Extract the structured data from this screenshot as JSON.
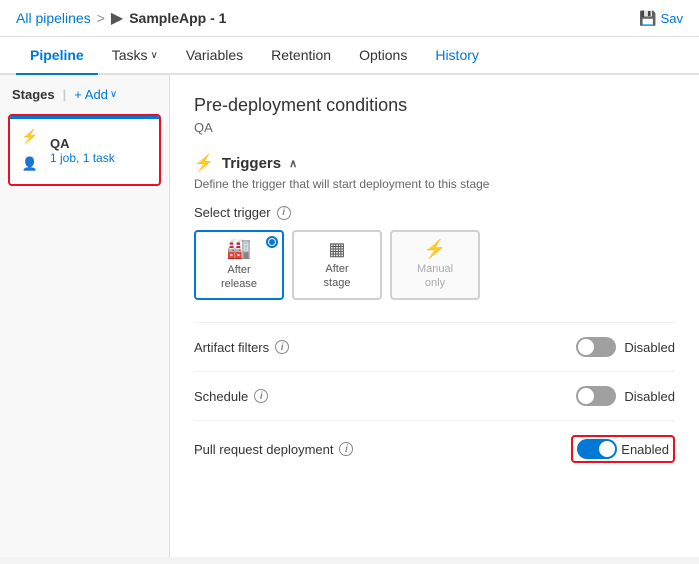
{
  "breadcrumb": {
    "all_pipelines": "All pipelines",
    "separator": ">",
    "app_icon": "▶",
    "current": "SampleApp - 1"
  },
  "save_button": "Sav",
  "nav": {
    "tabs": [
      {
        "id": "pipeline",
        "label": "Pipeline",
        "active": true
      },
      {
        "id": "tasks",
        "label": "Tasks",
        "has_dropdown": true
      },
      {
        "id": "variables",
        "label": "Variables"
      },
      {
        "id": "retention",
        "label": "Retention"
      },
      {
        "id": "options",
        "label": "Options"
      },
      {
        "id": "history",
        "label": "History"
      }
    ]
  },
  "sidebar": {
    "stages_label": "Stages",
    "add_label": "+ Add",
    "stage": {
      "name": "QA",
      "meta": "1 job, 1 task"
    }
  },
  "panel": {
    "title": "Pre-deployment conditions",
    "subtitle": "QA",
    "triggers_section": "Triggers",
    "triggers_desc": "Define the trigger that will start deployment to this stage",
    "select_trigger_label": "Select trigger",
    "trigger_options": [
      {
        "id": "after-release",
        "icon": "🏭",
        "label": "After\nrelease",
        "selected": true
      },
      {
        "id": "after-stage",
        "icon": "▦",
        "label": "After\nstage",
        "selected": false
      },
      {
        "id": "manual-only",
        "icon": "⚡",
        "label": "Manual\nonly",
        "selected": false,
        "disabled": true
      }
    ],
    "settings": [
      {
        "id": "artifact-filters",
        "label": "Artifact filters",
        "state": "off",
        "state_label": "Disabled"
      },
      {
        "id": "schedule",
        "label": "Schedule",
        "state": "off",
        "state_label": "Disabled"
      },
      {
        "id": "pull-request-deployment",
        "label": "Pull request deployment",
        "state": "on",
        "state_label": "Enabled",
        "highlighted": true
      }
    ]
  },
  "icons": {
    "trigger": "⚡",
    "save": "💾",
    "info": "i",
    "stage_lightning": "⚡",
    "stage_person": "👤",
    "chevron_down": "∨"
  }
}
